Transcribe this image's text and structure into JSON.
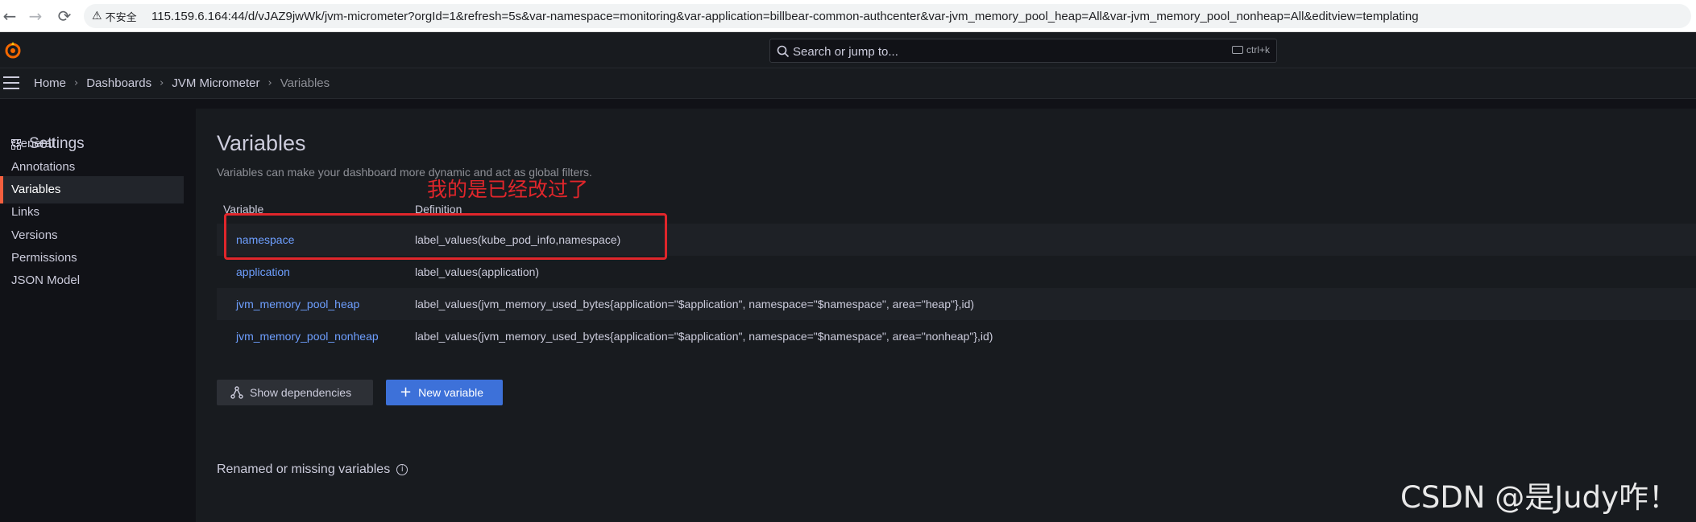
{
  "browser": {
    "back_glyph": "←",
    "forward_glyph": "→",
    "reload_glyph": "⟳",
    "security_label": "不安全",
    "url": "115.159.6.164:44/d/vJAZ9jwWk/jvm-micrometer?orgId=1&refresh=5s&var-namespace=monitoring&var-application=billbear-common-authcenter&var-jvm_memory_pool_heap=All&var-jvm_memory_pool_nonheap=All&editview=templating"
  },
  "topbar": {
    "search_placeholder": "Search or jump to...",
    "shortcut": "ctrl+k",
    "accent": "#f46800"
  },
  "breadcrumb": {
    "items": [
      "Home",
      "Dashboards",
      "JVM Micrometer",
      "Variables"
    ],
    "separator": "›"
  },
  "sidebar": {
    "title": "Settings",
    "items": [
      {
        "label": "General",
        "active": false
      },
      {
        "label": "Annotations",
        "active": false
      },
      {
        "label": "Variables",
        "active": true
      },
      {
        "label": "Links",
        "active": false
      },
      {
        "label": "Versions",
        "active": false
      },
      {
        "label": "Permissions",
        "active": false
      },
      {
        "label": "JSON Model",
        "active": false
      }
    ],
    "active_color": "#f55f3e"
  },
  "main": {
    "title": "Variables",
    "description": "Variables can make your dashboard more dynamic and act as global filters.",
    "table": {
      "headers": [
        "Variable",
        "Definition"
      ],
      "rows": [
        {
          "variable": "namespace",
          "definition": "label_values(kube_pod_info,namespace)"
        },
        {
          "variable": "application",
          "definition": "label_values(application)"
        },
        {
          "variable": "jvm_memory_pool_heap",
          "definition": "label_values(jvm_memory_used_bytes{application=\"$application\", namespace=\"$namespace\", area=\"heap\"},id)"
        },
        {
          "variable": "jvm_memory_pool_nonheap",
          "definition": "label_values(jvm_memory_used_bytes{application=\"$application\", namespace=\"$namespace\", area=\"nonheap\"},id)"
        }
      ]
    },
    "show_dependencies_label": "Show dependencies",
    "new_variable_label": "New variable",
    "new_variable_icon": "+",
    "renamed_label": "Renamed or missing variables",
    "info_icon_glyph": "i",
    "link_color": "#6e9fff",
    "primary_color": "#3d71d9"
  },
  "annotation": {
    "text": "我的是已经改过了",
    "color": "#e0262b"
  },
  "watermark": {
    "text": "CSDN @是Judy咋！"
  }
}
